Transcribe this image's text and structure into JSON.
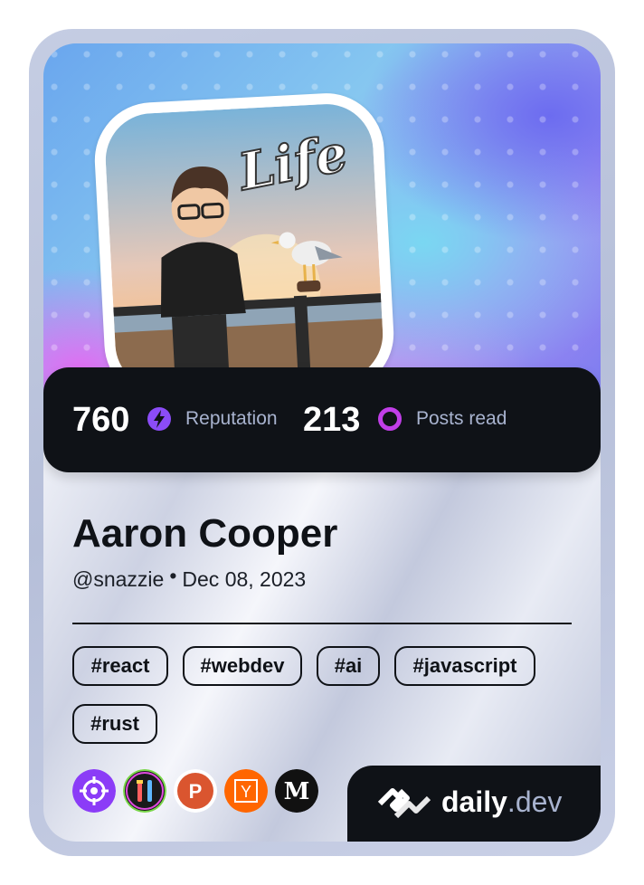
{
  "profile": {
    "name": "Aaron Cooper",
    "handle": "@snazzie",
    "separator": "•",
    "joined": "Dec 08, 2023",
    "avatar_text": "Life"
  },
  "stats": {
    "reputation_value": "760",
    "reputation_label": "Reputation",
    "posts_value": "213",
    "posts_label": "Posts read"
  },
  "tags": [
    "#react",
    "#webdev",
    "#ai",
    "#javascript",
    "#rust"
  ],
  "badges": [
    {
      "icon": "crosshair-icon",
      "color": "#8b3cf7"
    },
    {
      "icon": "tools-icon",
      "color": "#1a1a1a"
    },
    {
      "icon": "producthunt-icon",
      "color": "#da552f"
    },
    {
      "icon": "hackernews-icon",
      "color": "#ff6600"
    },
    {
      "icon": "medium-icon",
      "color": "#111111"
    }
  ],
  "brand": {
    "name": "daily",
    "suffix": ".dev"
  },
  "colors": {
    "reputation_accent": "#8b4cf7",
    "posts_accent": "#c13ee8",
    "dark": "#0f1217"
  }
}
